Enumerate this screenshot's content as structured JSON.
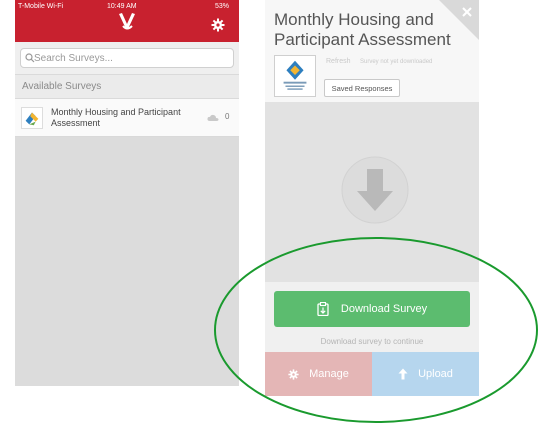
{
  "left_app": {
    "status": {
      "carrier": "T-Mobile Wi-Fi",
      "time": "10:49 AM",
      "battery": "53%"
    },
    "search": {
      "placeholder": "Search Surveys..."
    },
    "section_label": "Available Surveys",
    "surveys": [
      {
        "title": "Monthly Housing and Participant Assessment",
        "count": "0"
      }
    ],
    "colors": {
      "header": "#c8212f"
    },
    "icons": [
      "app-logo-icon",
      "gear-icon",
      "search-icon",
      "cloud-icon"
    ]
  },
  "right_app": {
    "title": "Monthly Housing and Participant Assessment",
    "refresh_label": "Refresh",
    "status_text": "Survey not yet downloaded",
    "saved_responses_label": "Saved Responses",
    "download_button_label": "Download Survey",
    "continue_text": "Download survey to continue",
    "manage_label": "Manage",
    "upload_label": "Upload",
    "colors": {
      "download": "#5cbc6f",
      "manage": "#e4b6b6",
      "upload": "#b6d6ee"
    },
    "icons": [
      "download-arrow-icon",
      "clipboard-icon",
      "gear-icon",
      "upload-arrow-icon",
      "close-icon"
    ]
  },
  "annotation": {
    "color": "#1a9a2e"
  }
}
